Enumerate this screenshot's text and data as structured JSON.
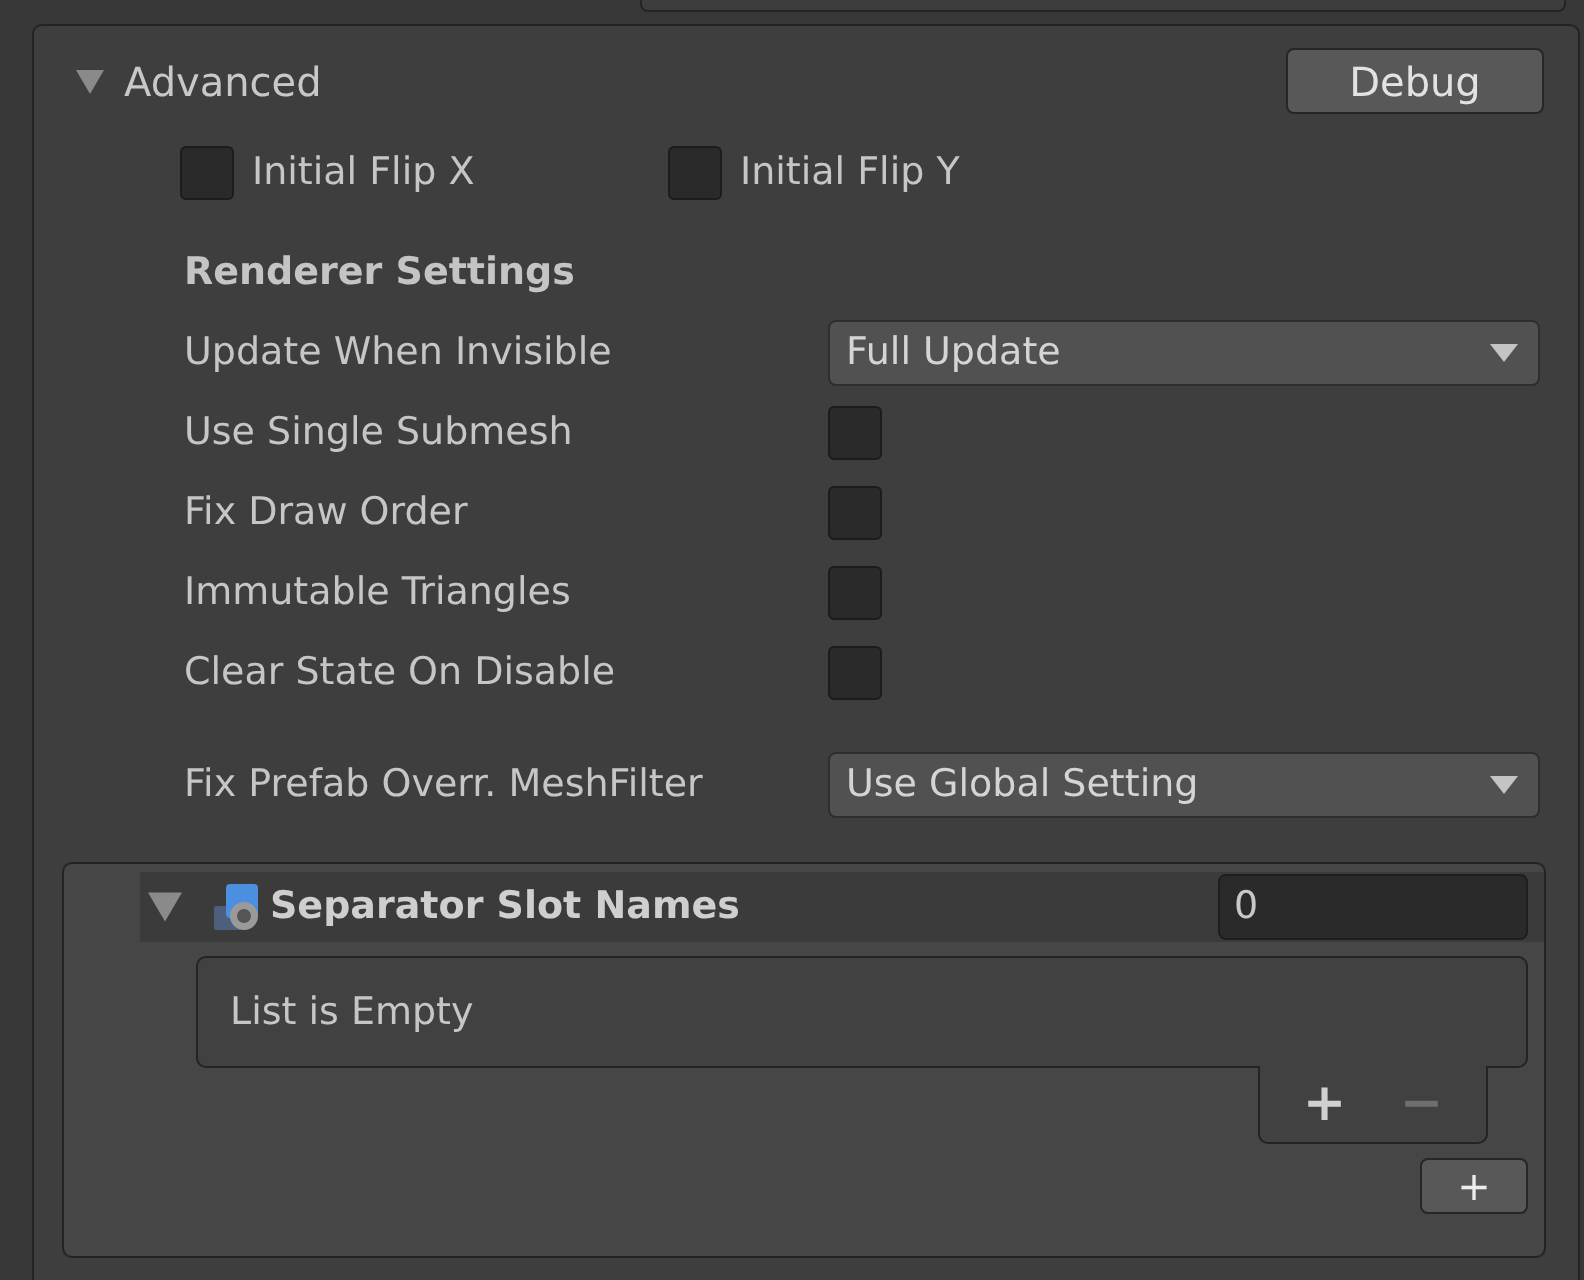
{
  "foldout": {
    "label": "Advanced",
    "expanded": true
  },
  "debug_button": {
    "label": "Debug"
  },
  "flip_options": [
    {
      "label": "Initial Flip X",
      "checked": false
    },
    {
      "label": "Initial Flip Y",
      "checked": false
    }
  ],
  "renderer_settings": {
    "heading": "Renderer Settings",
    "fields": [
      {
        "kind": "dropdown",
        "label": "Update When Invisible",
        "value": "Full Update"
      },
      {
        "kind": "checkbox",
        "label": "Use Single Submesh",
        "checked": false
      },
      {
        "kind": "checkbox",
        "label": "Fix Draw Order",
        "checked": false
      },
      {
        "kind": "checkbox",
        "label": "Immutable Triangles",
        "checked": false
      },
      {
        "kind": "checkbox",
        "label": "Clear State On Disable",
        "checked": false
      }
    ]
  },
  "prefab_override": {
    "label": "Fix Prefab Overr. MeshFilter",
    "value": "Use Global Setting"
  },
  "list": {
    "title": "Separator Slot Names",
    "expanded": true,
    "count": "0",
    "empty_message": "List is Empty",
    "footer_buttons": [
      {
        "label": "+",
        "disabled": false
      },
      {
        "label": "−",
        "disabled": true
      }
    ],
    "add_button": {
      "label": "+"
    }
  }
}
